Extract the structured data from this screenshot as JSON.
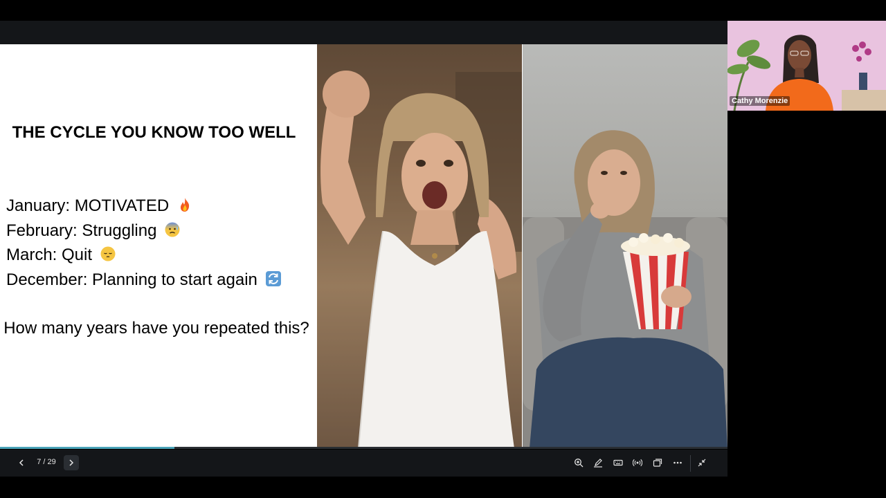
{
  "slide": {
    "title": "THE CYCLE YOU KNOW TOO WELL",
    "cycle": [
      {
        "label": "January: MOTIVATED",
        "icon": "fire-emoji"
      },
      {
        "label": "February: Struggling",
        "icon": "anxious-face-emoji"
      },
      {
        "label": "March: Quit",
        "icon": "pensive-face-emoji"
      },
      {
        "label": "December: Planning to start again",
        "icon": "repeat-arrows-emoji"
      }
    ],
    "question": "How many years have you repeated this?",
    "photos": [
      "celebrating-woman-photo",
      "woman-eating-popcorn-photo"
    ]
  },
  "presentation": {
    "current_page": 7,
    "total_pages": 29,
    "page_indicator": "7 / 29",
    "progress": 0.24,
    "accent_color": "#4aa3b8"
  },
  "toolbar": {
    "buttons": [
      "zoom-in-icon",
      "annotate-pen-icon",
      "keyboard-icon",
      "broadcast-icon",
      "window-icon",
      "more-options-icon",
      "exit-fullscreen-icon"
    ]
  },
  "participant": {
    "name": "Cathy Morenzie"
  }
}
